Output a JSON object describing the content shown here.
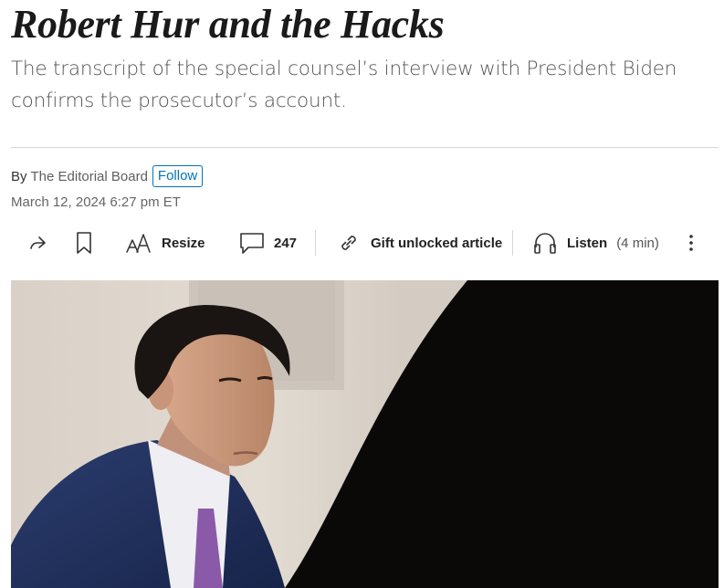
{
  "article": {
    "headline": "Robert Hur and the Hacks",
    "dek": "The transcript of the special counsel’s interview with President Biden confirms the prosecutor’s account.",
    "byline_prefix": "By",
    "author": "The Editorial Board",
    "follow_label": "Follow",
    "timestamp": "March 12, 2024 6:27 pm ET"
  },
  "toolbar": {
    "share_icon": "share-arrow-icon",
    "bookmark_icon": "bookmark-icon",
    "resize_label": "Resize",
    "comments_count": "247",
    "gift_label": "Gift unlocked article",
    "listen_label": "Listen",
    "listen_duration": "(4 min)",
    "more_icon": "more-vertical-icon"
  },
  "colors": {
    "accent": "#0274b6",
    "headline": "#1a1a1a",
    "dek": "#555555",
    "rule": "#d6d6d6"
  }
}
